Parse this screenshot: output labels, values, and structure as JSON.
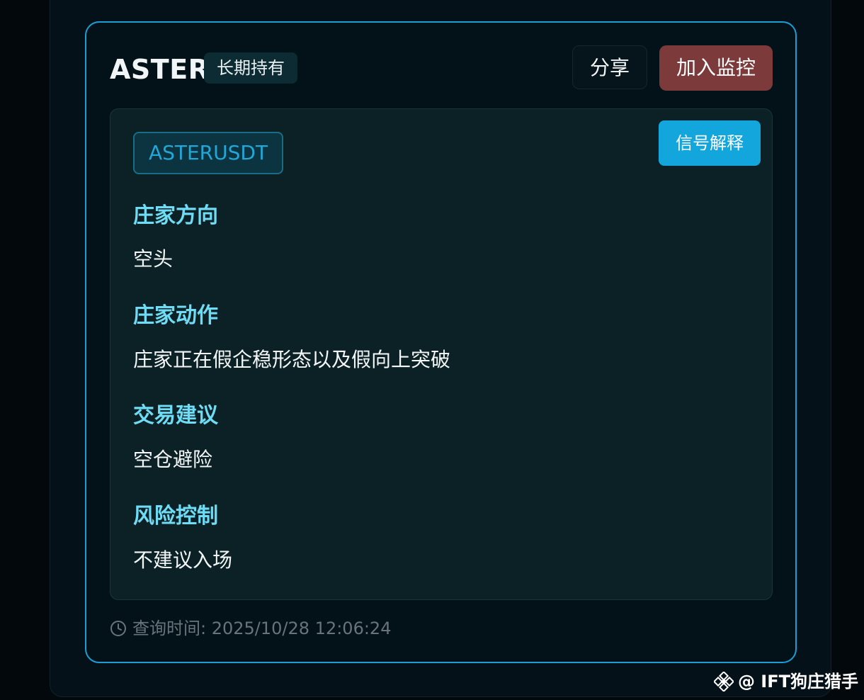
{
  "card": {
    "symbol": "ASTER",
    "hold_tag": "长期持有",
    "share_label": "分享",
    "monitor_label": "加入监控",
    "pair": "ASTERUSDT",
    "explain_label": "信号解释",
    "sections": [
      {
        "heading": "庄家方向",
        "value": "空头"
      },
      {
        "heading": "庄家动作",
        "value": "庄家正在假企稳形态以及假向上突破"
      },
      {
        "heading": "交易建议",
        "value": "空仓避险"
      },
      {
        "heading": "风险控制",
        "value": "不建议入场"
      }
    ],
    "query_time": "查询时间: 2025/10/28 12:06:24"
  },
  "watermark": {
    "text": "@ IFT狗庄猎手"
  },
  "icons": {
    "clock": "clock-icon",
    "logo": "diamond-logo-icon"
  },
  "colors": {
    "accent": "#1b9ed6",
    "heading": "#6fdcf5",
    "monitor": "#7c3a3b",
    "explain": "#13a6dc"
  }
}
